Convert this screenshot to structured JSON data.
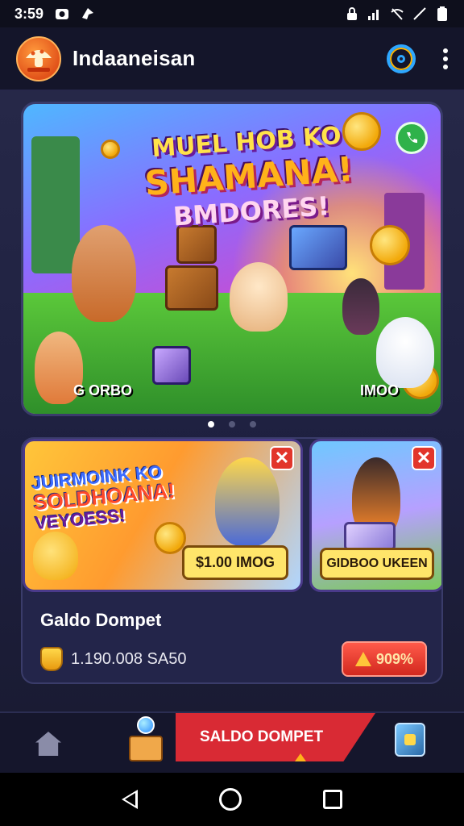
{
  "status_bar": {
    "time": "3:59"
  },
  "app_bar": {
    "title": "Indaaneisan",
    "logo_text": ""
  },
  "hero": {
    "title_line1": "MUEL HOB KO",
    "title_line2": "SHAMANA!",
    "title_line3": "BMDORES!",
    "caption_left": "G ORBO",
    "caption_right": "IMOO"
  },
  "carousel": {
    "active_index": 0,
    "count": 3
  },
  "wallet": {
    "promo_a": {
      "line1": "JUIRMOINK KO",
      "line2": "SOLDHOANA!",
      "line3": "VEYOESS!",
      "tag": "$1.00 IMOG"
    },
    "promo_b": {
      "tag": "GIDBOO UKEEN"
    },
    "close_symbol": "✕",
    "title": "Galdo Dompet",
    "amount": "1.190.008 SA50",
    "percent_button": "909%"
  },
  "bottom_nav": {
    "cta_label": "SALDO DOMPET"
  },
  "colors": {
    "accent_red": "#d92a34",
    "bg": "#1c1d33",
    "accent_blue": "#2ea7ff"
  }
}
